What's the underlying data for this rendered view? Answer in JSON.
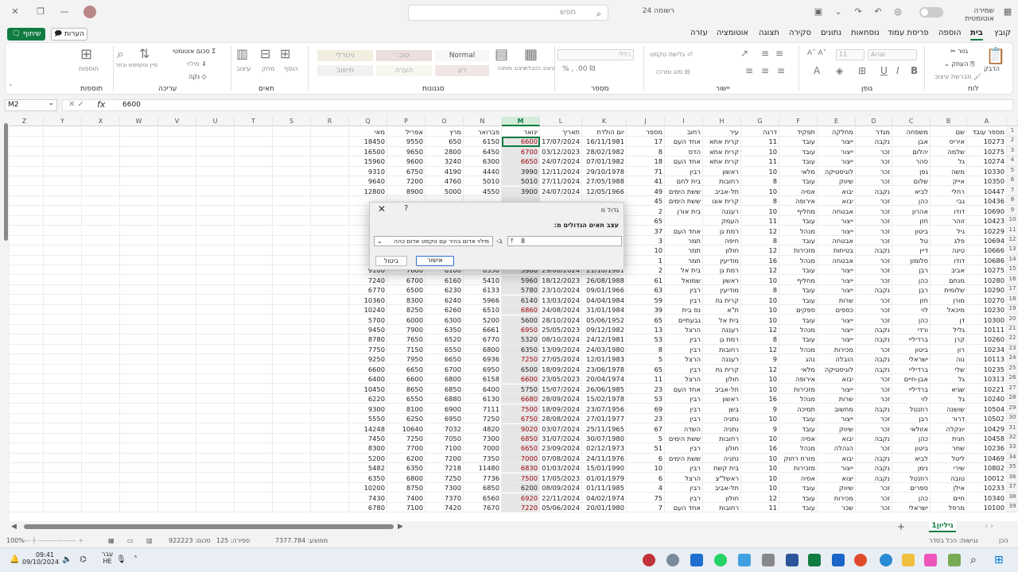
{
  "window": {
    "filename": "רשומה 24",
    "autosave_label": "שמירה אוטומטית",
    "search_placeholder": "חפש"
  },
  "tabs": [
    "קובץ",
    "בית",
    "הוספה",
    "פריסת עמוד",
    "נוסחאות",
    "נתונים",
    "סקירה",
    "תצוגה",
    "אוטומציה",
    "עזרה"
  ],
  "active_tab": "בית",
  "share_label": "שיתוף",
  "comments_label": "הערות",
  "ribbon": {
    "groups": [
      "לוח",
      "גופן",
      "יישור",
      "מספר",
      "סגנונות",
      "תאים",
      "עריכה",
      "תוספות"
    ],
    "clipboard": {
      "paste": "הדבק",
      "cut": "גזור",
      "copy": "העתק",
      "format_painter": "מברשת עיצוב"
    },
    "font": {
      "name": "Arial",
      "size": "11"
    },
    "alignment": {
      "wrap": "גלישת טקסט",
      "merge": "מזג ומרכז"
    },
    "number": {
      "format": "כללי"
    },
    "styles": {
      "conditional": "עיצוב מותנה",
      "as_table": "עיצוב כטבלה",
      "normal": "Normal",
      "bad": "רע",
      "good": "טוב",
      "neutral": "ניטרלי",
      "calculation": "חישוב",
      "note": "הערה"
    },
    "cells": {
      "insert": "הוסף",
      "delete": "מחק",
      "format": "עיצוב"
    },
    "editing": {
      "autosum": "סכום אוטומטי",
      "fill": "מילוי",
      "clear": "נקה",
      "sort": "מיין וסנן",
      "find": "חפש ובחר"
    },
    "addins": "תוספות"
  },
  "formula_bar": {
    "name_box": "M2",
    "fx": "fx",
    "value": "6600"
  },
  "columns": [
    "A",
    "B",
    "C",
    "D",
    "E",
    "F",
    "G",
    "H",
    "I",
    "J",
    "K",
    "L",
    "M",
    "N",
    "O",
    "P",
    "Q",
    "R",
    "S",
    "T",
    "U",
    "V",
    "W",
    "X",
    "Y",
    "Z"
  ],
  "headers": [
    "מספר עובד",
    "שם",
    "משפחה",
    "מגדר",
    "מחלקה",
    "תפקיד",
    "דרגה",
    "עיר",
    "רחוב",
    "מספר",
    "יום הולדת",
    "תאריך",
    "ינואר",
    "פברואר",
    "מרץ",
    "אפריל",
    "מאי"
  ],
  "rows": [
    [
      "10273",
      "איריס",
      "אבן",
      "נקבה",
      "ייצור",
      "עובד",
      "11",
      "קרית אתא",
      "אחד העם",
      "17",
      "16/11/1981",
      "17/07/2024",
      "6600",
      "6150",
      "650",
      "9550",
      "18450"
    ],
    [
      "10275",
      "שלמה",
      "יהלום",
      "זכר",
      "ייצור",
      "עובד",
      "10",
      "קרית אתא",
      "הדס",
      "8",
      "28/02/1982",
      "03/12/2023",
      "6700",
      "6450",
      "2800",
      "9650",
      "16500"
    ],
    [
      "10274",
      "גל",
      "סהר",
      "זכר",
      "ייצור",
      "עובד",
      "11",
      "קרית אתא",
      "אחד העם",
      "18",
      "07/01/1982",
      "24/07/2024",
      "6650",
      "6300",
      "3240",
      "9600",
      "15960"
    ],
    [
      "10330",
      "משה",
      "גפן",
      "זכר",
      "לוגיסטיקה",
      "מלאי",
      "10",
      "ראשון",
      "רבין",
      "71",
      "29/10/1978",
      "12/11/2024",
      "3990",
      "4440",
      "4190",
      "6750",
      "9310"
    ],
    [
      "10350",
      "אייק",
      "שלום",
      "זכר",
      "שיווק",
      "עובד",
      "8",
      "רחובות",
      "בית לחם",
      "41",
      "27/05/1988",
      "27/11/2024",
      "5010",
      "5010",
      "4760",
      "7200",
      "9640"
    ],
    [
      "10447",
      "רחלי",
      "לביא",
      "נקבה",
      "יבוא",
      "אסיה",
      "10",
      "תל-אביב",
      "ששת הימים",
      "49",
      "12/05/1966",
      "24/07/2024",
      "3900",
      "4550",
      "5000",
      "8900",
      "12800"
    ],
    [
      "10436",
      "גבי",
      "כהן",
      "זכר",
      "יבוא",
      "אירופה",
      "8",
      "קרית אונו",
      "ששת הימים",
      "45",
      "",
      "",
      "",
      "",
      "",
      "",
      ""
    ],
    [
      "10690",
      "דודו",
      "אהרון",
      "זכר",
      "אבטחה",
      "מחליף",
      "10",
      "רעננה",
      "בית אורן",
      "2",
      "",
      "",
      "",
      "",
      "",
      "",
      ""
    ],
    [
      "10423",
      "זוהר",
      "חזן",
      "זכר",
      "ייצור",
      "עובד",
      "11",
      "העמק",
      "",
      "65",
      "",
      "",
      "",
      "",
      "",
      "",
      ""
    ],
    [
      "10229",
      "גיל",
      "ביטון",
      "זכר",
      "ייצור",
      "מנהל",
      "12",
      "רמת גן",
      "אחד העם",
      "37",
      "",
      "",
      "",
      "",
      "",
      "",
      ""
    ],
    [
      "10694",
      "פלג",
      "טל",
      "זכר",
      "אבטחה",
      "עובד",
      "8",
      "חיפה",
      "תמר",
      "3",
      "",
      "",
      "",
      "",
      "",
      "",
      ""
    ],
    [
      "10666",
      "טינה",
      "דיין",
      "נקבה",
      "בטיחות",
      "מזכירות",
      "12",
      "חולון",
      "תמר",
      "10",
      "",
      "",
      "",
      "",
      "",
      "",
      ""
    ],
    [
      "10686",
      "דודו",
      "סלומון",
      "זכר",
      "אבטחה",
      "מנהל",
      "16",
      "מודיעין",
      "תמר",
      "1",
      "",
      "",
      "",
      "",
      "",
      "",
      ""
    ],
    [
      "10275",
      "אביב",
      "רבן",
      "זכר",
      "ייצור",
      "עובד",
      "12",
      "רמת גן",
      "בית אל",
      "2",
      "21/10/1981",
      "29/08/2024",
      "5900",
      "6350",
      "6100",
      "7600",
      "9100"
    ],
    [
      "10280",
      "מנחם",
      "כהן",
      "זכר",
      "ייצור",
      "מחליף",
      "10",
      "ראשון",
      "שמואל",
      "61",
      "26/08/1988",
      "18/12/2023",
      "5960",
      "5410",
      "6160",
      "6700",
      "7240"
    ],
    [
      "10290",
      "שלומית",
      "רבן",
      "נקבה",
      "ייצור",
      "עובד",
      "8",
      "מודיעין",
      "רבין",
      "63",
      "09/01/1966",
      "23/10/2024",
      "5780",
      "6133",
      "6230",
      "6500",
      "6770"
    ],
    [
      "10270",
      "מורן",
      "חזן",
      "זכר",
      "שרות",
      "עובד",
      "10",
      "קרית גת",
      "רבין",
      "59",
      "04/04/1984",
      "13/03/2024",
      "6140",
      "5966",
      "6240",
      "8300",
      "10360"
    ],
    [
      "10230",
      "מיכאל",
      "לוי",
      "זכר",
      "כספים",
      "ספקים",
      "10",
      "ת\"א",
      "נס בית",
      "39",
      "31/01/1984",
      "24/08/2024",
      "6860",
      "6510",
      "6260",
      "8250",
      "10240"
    ],
    [
      "10300",
      "דן",
      "כהן",
      "זכר",
      "ייצור",
      "עובד",
      "10",
      "בית אל",
      "גבעתיים",
      "65",
      "05/06/1952",
      "28/10/2024",
      "5600",
      "5200",
      "6300",
      "6000",
      "5700"
    ],
    [
      "10111",
      "גליל",
      "ורדי",
      "נקבה",
      "ייצור",
      "מנהל",
      "12",
      "רעננה",
      "הרצל",
      "13",
      "09/12/1982",
      "25/05/2023",
      "6950",
      "6661",
      "6350",
      "7900",
      "9450"
    ],
    [
      "10260",
      "קרן",
      "ברדיליי",
      "נקבה",
      "ייצור",
      "עובד",
      "8",
      "רמת גן",
      "רבין",
      "53",
      "24/12/1981",
      "08/10/2024",
      "5320",
      "6770",
      "6520",
      "7650",
      "8780"
    ],
    [
      "10234",
      "רון",
      "ביטון",
      "זכר",
      "מכירות",
      "מנהל",
      "12",
      "רחובות",
      "רבין",
      "8",
      "24/03/1980",
      "13/09/2024",
      "6350",
      "6800",
      "6550",
      "7150",
      "7750"
    ],
    [
      "10113",
      "נוה",
      "ישראלי",
      "נקבה",
      "הובלה",
      "נהג",
      "9",
      "רעננה",
      "הרצל",
      "5",
      "12/01/1983",
      "27/05/2024",
      "7250",
      "6936",
      "6650",
      "7950",
      "9250"
    ],
    [
      "10235",
      "שלי",
      "ברדיליי",
      "נקבה",
      "לוגיסטיקה",
      "מלאי",
      "12",
      "קרית גת",
      "רבין",
      "65",
      "23/06/1978",
      "18/09/2024",
      "6500",
      "6950",
      "6700",
      "6650",
      "6600"
    ],
    [
      "10313",
      "גל",
      "אבן-חיים",
      "זכר",
      "יבוא",
      "אירופה",
      "10",
      "חולון",
      "הרצל",
      "11",
      "20/04/1974",
      "23/05/2023",
      "6600",
      "6158",
      "6800",
      "6600",
      "6400"
    ],
    [
      "10221",
      "שגיא",
      "ברדיליי",
      "זכר",
      "ייצור",
      "מזכירות",
      "10",
      "תל-אביב",
      "אחד העם",
      "23",
      "26/06/1985",
      "15/07/2024",
      "5750",
      "6400",
      "6850",
      "8650",
      "10450"
    ],
    [
      "10240",
      "גל",
      "לוי",
      "זכר",
      "שרות",
      "מנהל",
      "16",
      "ראשון",
      "רבין",
      "53",
      "15/02/1978",
      "28/09/2024",
      "6680",
      "6130",
      "6880",
      "6550",
      "6220"
    ],
    [
      "10504",
      "שושנה",
      "רוזנטל",
      "נקבה",
      "מחשוב",
      "תמיכה",
      "9",
      "בשן",
      "רבין",
      "69",
      "23/07/1956",
      "18/09/2024",
      "7500",
      "7111",
      "6900",
      "8100",
      "9300"
    ],
    [
      "10502",
      "דרור",
      "רבן",
      "זכר",
      "ייצור",
      "עובד",
      "10",
      "נתניה",
      "רבין",
      "23",
      "27/01/1977",
      "28/08/2024",
      "6750",
      "7250",
      "6950",
      "6250",
      "5550"
    ],
    [
      "10429",
      "יונקלה",
      "אזולאי",
      "זכר",
      "שיווק",
      "עובד",
      "9",
      "נתניה",
      "השדה",
      "67",
      "25/11/1965",
      "03/07/2024",
      "9020",
      "4820",
      "7032",
      "10640",
      "14248"
    ],
    [
      "10458",
      "חגית",
      "כהן",
      "נקבה",
      "יבוא",
      "אסיה",
      "10",
      "רחובות",
      "ששת הימים",
      "5",
      "30/07/1980",
      "31/07/2024",
      "6850",
      "7300",
      "7050",
      "7250",
      "7450"
    ],
    [
      "10236",
      "שחר",
      "ביטון",
      "זכר",
      "הנהלה",
      "מנהל",
      "16",
      "חולון",
      "רבין",
      "51",
      "02/12/1973",
      "23/09/2024",
      "6650",
      "7000",
      "7100",
      "7700",
      "8300"
    ],
    [
      "10469",
      "ליטל",
      "לביא",
      "נקבה",
      "יבוא",
      "מזרח רחוק",
      "10",
      "נתניה",
      "ששת הימים",
      "6",
      "24/11/1976",
      "07/08/2024",
      "7000",
      "7350",
      "7200",
      "6200",
      "5200"
    ],
    [
      "10802",
      "שירי",
      "נימן",
      "נקבה",
      "ייצור",
      "מזכירות",
      "10",
      "בית קשת",
      "רבין",
      "10",
      "15/01/1990",
      "01/03/2024",
      "6830",
      "11480",
      "7218",
      "6350",
      "5482"
    ],
    [
      "10012",
      "טובה",
      "רוזנטל",
      "נקבה",
      "יצוא",
      "אסיה",
      "10",
      "ראשל\"צ",
      "הרצל",
      "6",
      "01/01/1979",
      "17/05/2023",
      "7500",
      "7736",
      "7250",
      "6800",
      "6350"
    ],
    [
      "10233",
      "אילן",
      "ספרים",
      "זכר",
      "שיווק",
      "עובד",
      "10",
      "תל-אביב",
      "רבין",
      "4",
      "01/11/1985",
      "08/09/2024",
      "6200",
      "6850",
      "7300",
      "8750",
      "10200"
    ],
    [
      "10340",
      "חיים",
      "כהן",
      "זכר",
      "מכירות",
      "עובד",
      "12",
      "חולון",
      "רבין",
      "75",
      "04/02/1974",
      "22/11/2024",
      "6920",
      "6560",
      "7370",
      "7400",
      "7430"
    ],
    [
      "10100",
      "מרסל",
      "ישראלי",
      "זכר",
      "שכר",
      "עובד",
      "11",
      "רחובות",
      "אחד העם",
      "7",
      "20/01/1980",
      "05/06/2024",
      "7220",
      "7670",
      "7420",
      "7100",
      "6780"
    ]
  ],
  "highlighted": [
    "6600",
    "6700",
    "6650",
    "6860",
    "6950",
    "7250",
    "6600",
    "6680",
    "7500",
    "6750",
    "9020",
    "6850",
    "6650",
    "7000",
    "6830",
    "7500",
    "6920",
    "7220"
  ],
  "dialog": {
    "title": "גדול מ",
    "help": "?",
    "prompt": "עצב תאים הגדולים מ:",
    "input_value": "8",
    "with_label": "ב-",
    "format_option": "מילוי אדום בהיר עם טקסט אדום כהה",
    "ok_label": "אישור",
    "cancel_label": "ביטול"
  },
  "sheet": {
    "tab_name": "גיליון1"
  },
  "status": {
    "ready": "הכן",
    "accessibility": "נגישות: הכל בסדר",
    "average": "ממוצע: 7377.784",
    "count": "ספירה: 125",
    "sum": "סכום: 922223",
    "zoom": "100%"
  },
  "taskbar": {
    "time": "09:41",
    "date": "09/10/2024",
    "lang": "עבר",
    "lang2": "HE"
  }
}
